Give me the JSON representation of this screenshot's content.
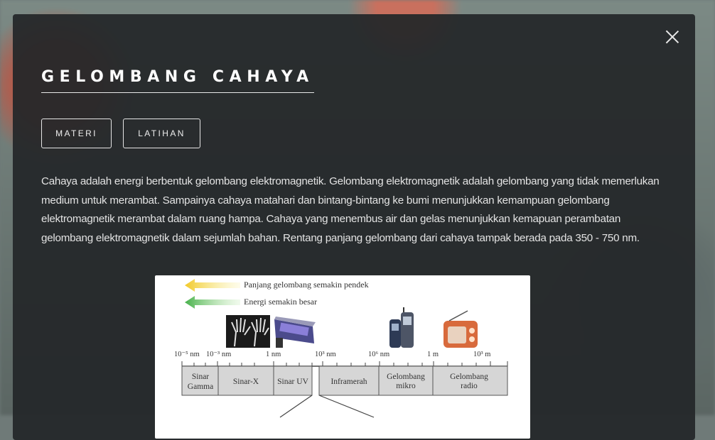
{
  "modal": {
    "title": "GELOMBANG CAHAYA",
    "tabs": [
      {
        "label": "MATERI"
      },
      {
        "label": "LATIHAN"
      }
    ],
    "paragraph": "Cahaya adalah energi berbentuk gelombang elektromagnetik. Gelombang elektromagnetik adalah gelombang yang tidak memerlukan medium untuk merambat. Sampainya cahaya matahari dan bintang-bintang ke bumi menunjukkan kemampuan gelombang elektromagnetik merambat dalam ruang hampa. Cahaya yang menembus air dan gelas menunjukkan kemapuan perambatan gelombang elektromagnetik dalam sejumlah bahan. Rentang panjang gelombang dari cahaya tampak berada pada 350 - 750 nm."
  },
  "figure": {
    "arrow1_label": "Panjang gelombang semakin pendek",
    "arrow2_label": "Energi semakin besar",
    "arrow1_color": "#f4d23a",
    "arrow2_color": "#5cc05a",
    "scale_labels": [
      "10⁻⁵ nm",
      "10⁻³ nm",
      "1 nm",
      "10³ nm",
      "10⁶ nm",
      "1 m",
      "10³ m"
    ],
    "bands": [
      {
        "line1": "Sinar",
        "line2": "Gamma"
      },
      {
        "line1": "Sinar-X",
        "line2": ""
      },
      {
        "line1": "Sinar UV",
        "line2": ""
      },
      {
        "line1": "Inframerah",
        "line2": ""
      },
      {
        "line1": "Gelombang",
        "line2": "mikro"
      },
      {
        "line1": "Gelombang",
        "line2": "radio"
      }
    ],
    "icons": [
      "xray-hands-icon",
      "uv-lamp-icon",
      "mobile-phones-icon",
      "radio-icon"
    ]
  }
}
